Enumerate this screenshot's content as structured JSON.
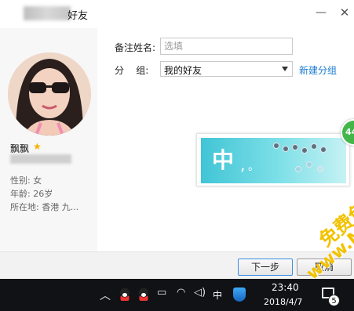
{
  "window": {
    "title_suffix": "好友",
    "minimize": "—",
    "close": "✕"
  },
  "profile": {
    "name": "飘飘",
    "gender_label": "性别:",
    "gender": "女",
    "age_label": "年龄:",
    "age": "26岁",
    "location_label": "所在地:",
    "location": "香港 九..."
  },
  "form": {
    "remark_label": "备注姓名:",
    "remark_placeholder": "选填",
    "group_label": "分    组:",
    "group_value": "我的好友",
    "new_group_link": "新建分组"
  },
  "ad": {
    "char": "中",
    "comma": ",",
    "dot": "。"
  },
  "buttons": {
    "next": "下一步",
    "cancel": "取消"
  },
  "float_badge": "44",
  "taskbar": {
    "ime": "中",
    "time": "23:40",
    "date": "2018/4/7",
    "notification_count": "5"
  },
  "watermark": {
    "line1": "免费色色 -",
    "line2": "www.MFsese.com"
  },
  "colors": {
    "link": "#1a7ad1",
    "star": "#f5b400",
    "badge": "#43b649",
    "watermark": "#f2c200",
    "taskbar": "#101215"
  }
}
